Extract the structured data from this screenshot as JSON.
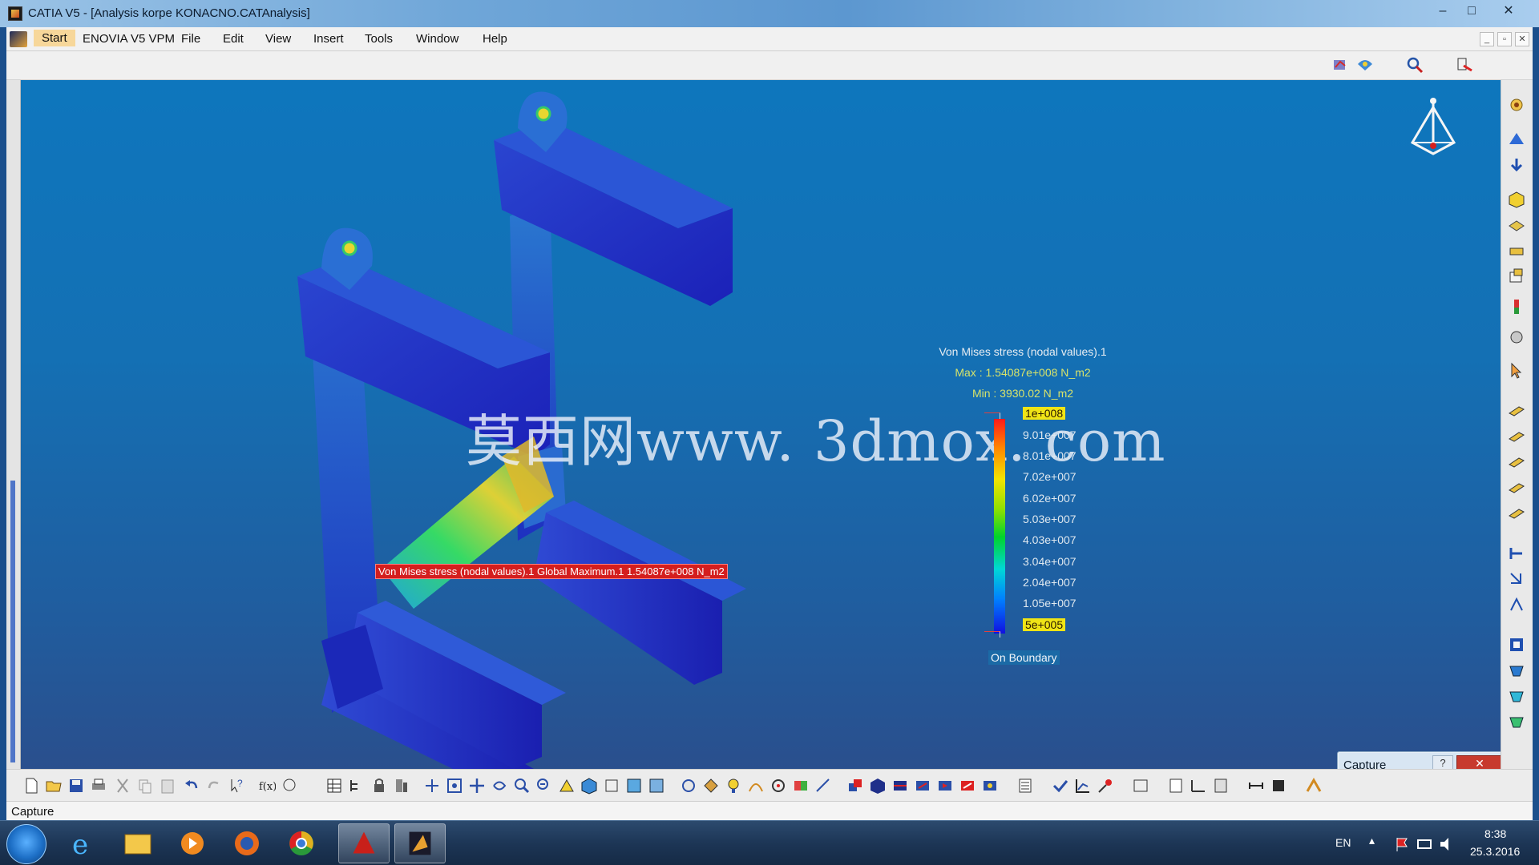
{
  "window": {
    "title": "CATIA V5 - [Analysis korpe KONACNO.CATAnalysis]",
    "controls": {
      "minimize": "–",
      "maximize": "□",
      "close": "✕"
    }
  },
  "menu": {
    "items": [
      "Start",
      "ENOVIA V5 VPM",
      "File",
      "Edit",
      "View",
      "Insert",
      "Tools",
      "Window",
      "Help"
    ]
  },
  "viewport": {
    "watermark": "莫西网www. 3dmox. com",
    "max_tag": "Von Mises stress (nodal values).1  Global Maximum.1  1.54087e+008 N_m2"
  },
  "legend": {
    "title": "Von Mises stress (nodal values).1",
    "max": "Max : 1.54087e+008 N_m2",
    "min": "Min : 3930.02 N_m2",
    "values": [
      "1e+008",
      "9.01e+007",
      "8.01e+007",
      "7.02e+007",
      "6.02e+007",
      "5.03e+007",
      "4.03e+007",
      "3.04e+007",
      "2.04e+007",
      "1.05e+007",
      "5e+005"
    ],
    "on_boundary": "On Boundary"
  },
  "capture_panel": {
    "title": "Capture",
    "help": "?",
    "close": "✕"
  },
  "status": {
    "text": "Capture"
  },
  "taskbar": {
    "lang": "EN",
    "time": "8:38",
    "date": "25.3.2016"
  },
  "colors": {
    "viewport_top": "#0e76bd",
    "viewport_bottom": "#2a4f8d",
    "tag_red": "#d41e1e",
    "legend_highlight": "#f0e416"
  }
}
